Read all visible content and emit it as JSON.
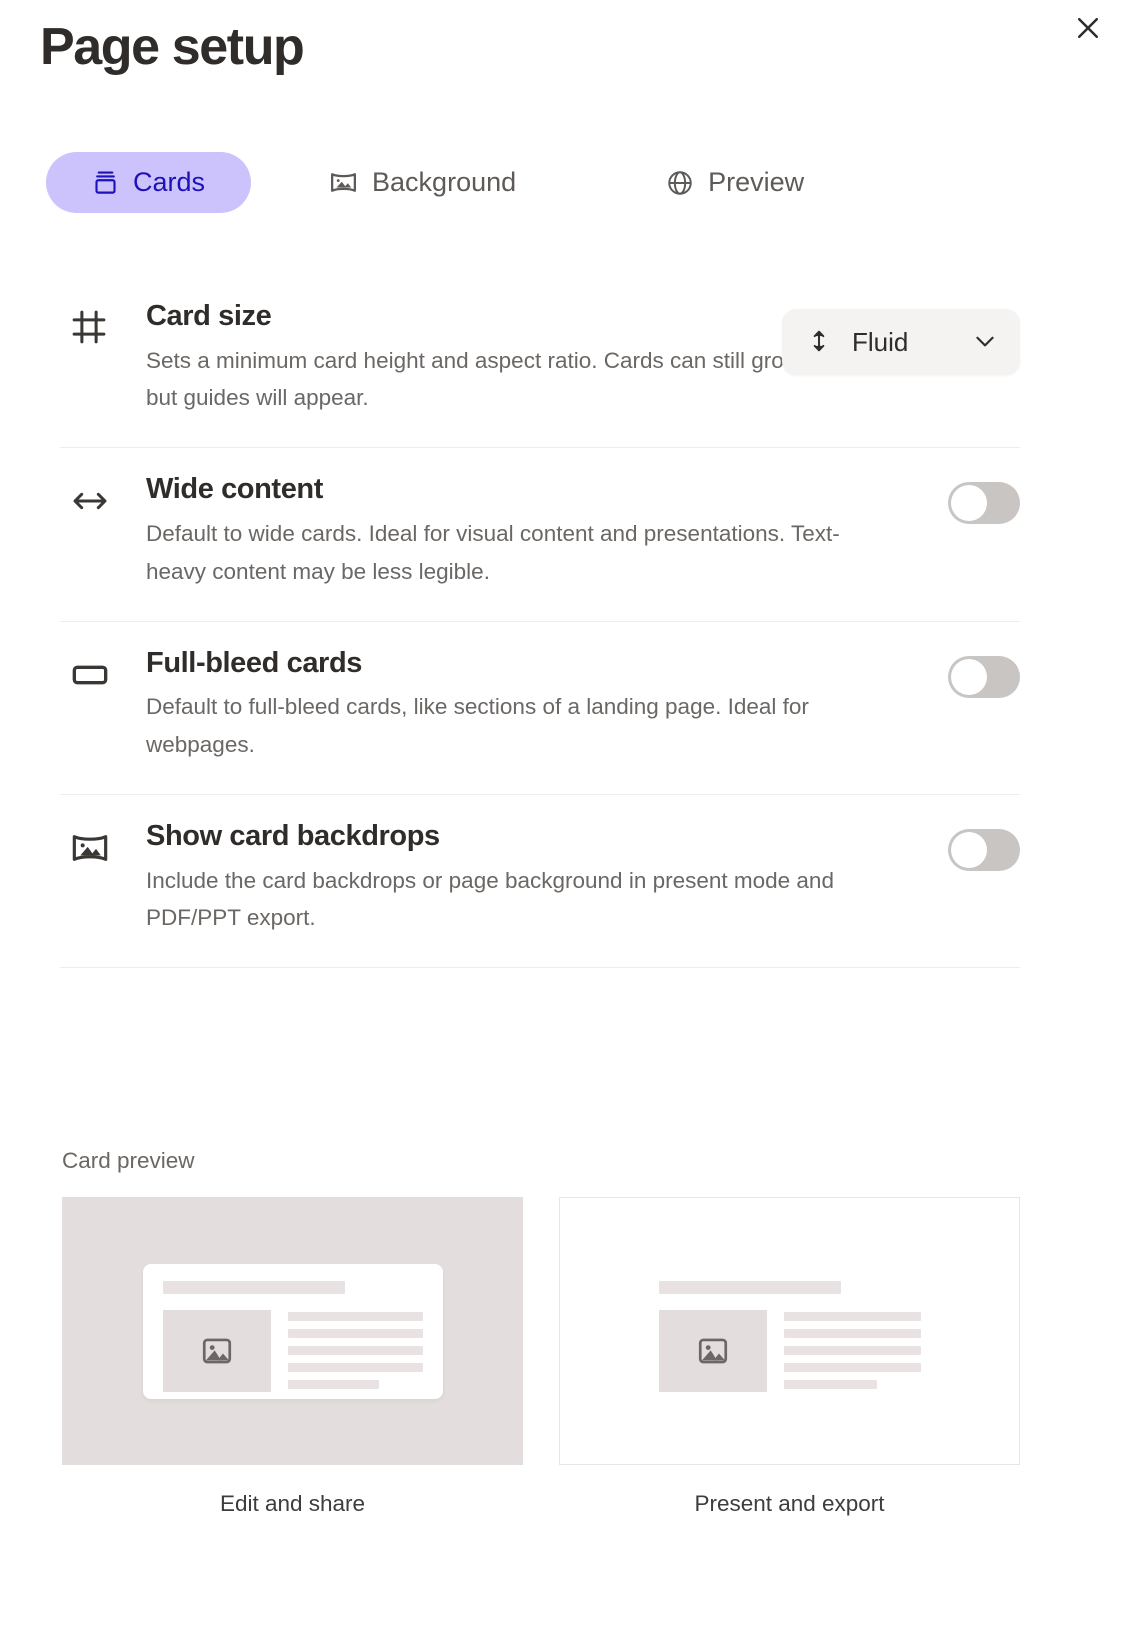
{
  "dialog": {
    "title": "Page setup",
    "close_label": "Close",
    "close_icon": "close-icon"
  },
  "tabs": [
    {
      "label": "Cards",
      "icon": "cards-icon",
      "active": true
    },
    {
      "label": "Background",
      "icon": "image-icon",
      "active": false
    },
    {
      "label": "Preview",
      "icon": "globe-icon",
      "active": false
    }
  ],
  "settings": [
    {
      "id": "card-size",
      "icon": "crop-frame-icon",
      "title": "Card size",
      "description": "Sets a minimum card height and aspect ratio. Cards can still grow taller, but guides will appear.",
      "control": "dropdown",
      "value": "Fluid",
      "dropdown_icon": "vertical-resize-icon",
      "chevron_icon": "chevron-down-icon"
    },
    {
      "id": "wide-content",
      "icon": "horizontal-arrows-icon",
      "title": "Wide content",
      "description": "Default to wide cards. Ideal for visual content and presentations. Text-heavy content may be less legible.",
      "control": "toggle",
      "value": "off"
    },
    {
      "id": "full-bleed-cards",
      "icon": "rounded-rectangle-icon",
      "title": "Full-bleed cards",
      "description": "Default to full-bleed cards, like sections of a landing page. Ideal for webpages.",
      "control": "toggle",
      "value": "off"
    },
    {
      "id": "show-card-backdrops",
      "icon": "image-icon",
      "title": "Show card backdrops",
      "description": "Include the card backdrops or page background in present mode and PDF/PPT export.",
      "control": "toggle",
      "value": "off"
    }
  ],
  "card_preview": {
    "label": "Card preview",
    "items": [
      {
        "id": "edit-and-share",
        "caption": "Edit and share",
        "style": "shaded"
      },
      {
        "id": "present-and-export",
        "caption": "Present and export",
        "style": "outlined"
      }
    ],
    "placeholder_icon": "image-placeholder-icon"
  },
  "colors": {
    "accent_bg": "#ccc3fd",
    "accent_text": "#1d11b8",
    "title": "#2f2c2a",
    "muted_text": "#6b6764",
    "toggle_off_track": "#c9c5c3",
    "divider": "#ececec",
    "preview_shade": "#e3dedd",
    "dropdown_bg": "#f4f3f2"
  }
}
